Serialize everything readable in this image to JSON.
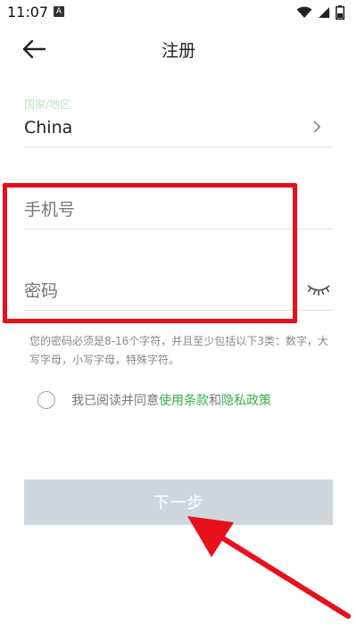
{
  "status_bar": {
    "time": "11:07",
    "notification_letter": "A"
  },
  "header": {
    "title": "注册"
  },
  "region": {
    "label": "国家/地区",
    "value": "China"
  },
  "phone": {
    "placeholder": "手机号"
  },
  "password": {
    "placeholder": "密码"
  },
  "hint": "您的密码必须是8-16个字符，并且至少包括以下3类：数字，大写字母，小写字母，特殊字符。",
  "agreement": {
    "prefix": "我已阅读并同意",
    "terms": "使用条款",
    "and": "和",
    "privacy": "隐私政策",
    "checked": false
  },
  "next_button_label": "下一步",
  "colors": {
    "accent": "#36b04a",
    "annotation": "#e8101a",
    "button_disabled": "#cfd7dd"
  }
}
